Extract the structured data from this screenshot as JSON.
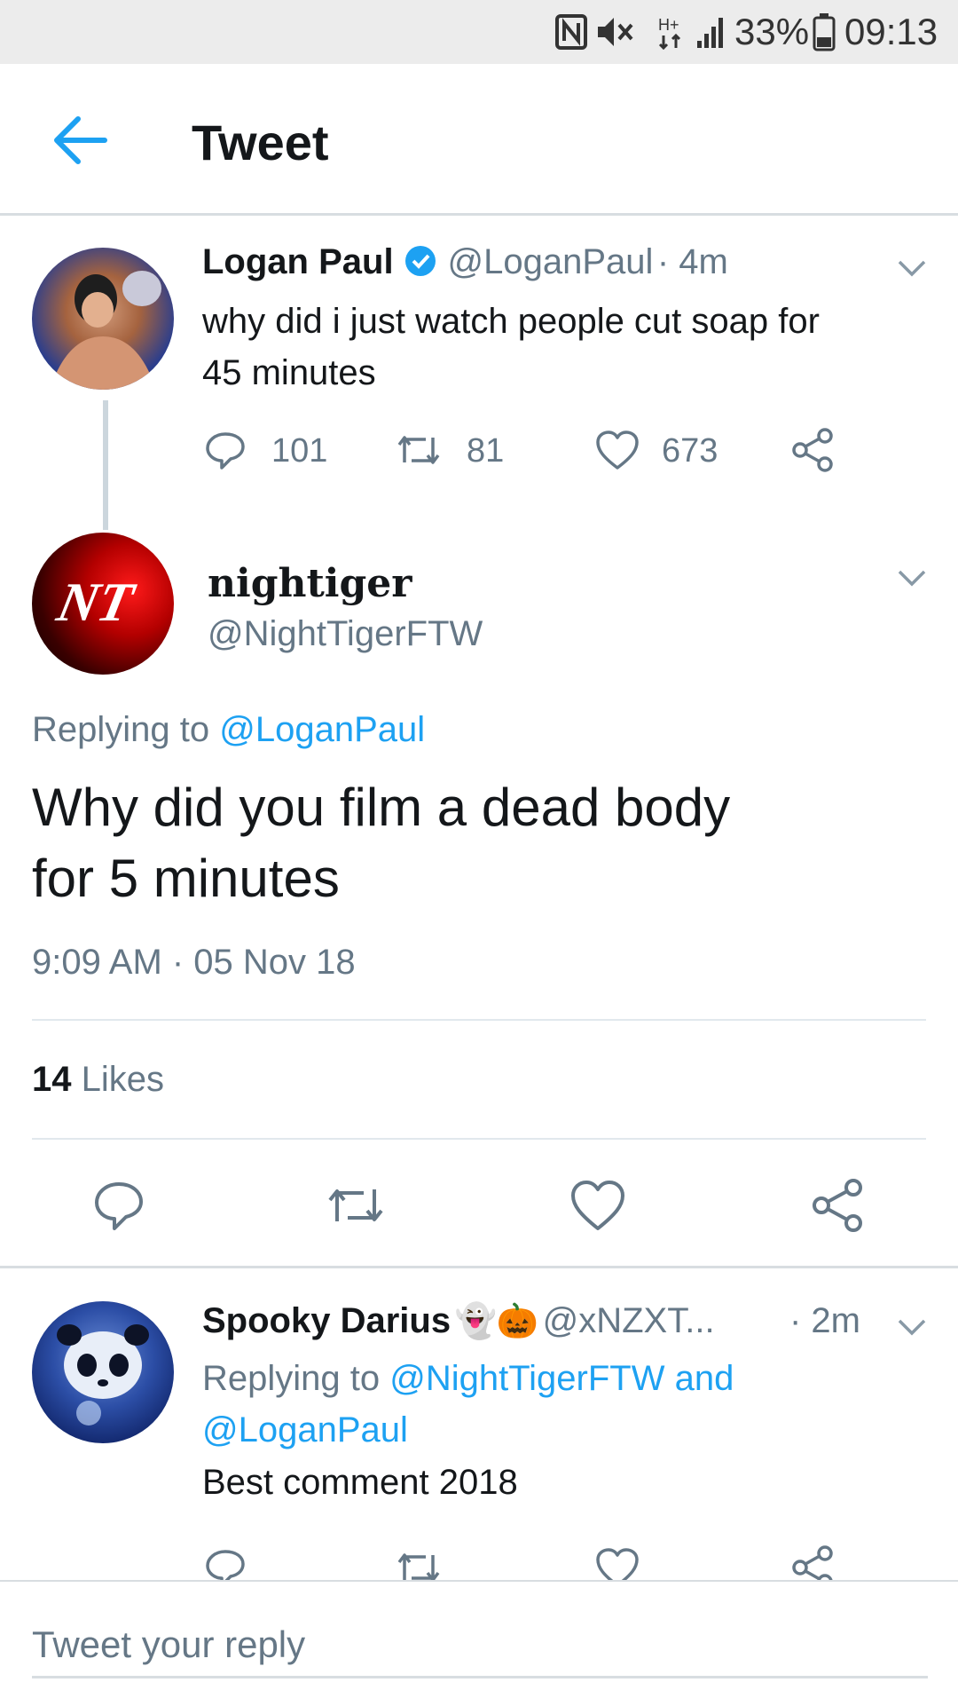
{
  "status_bar": {
    "battery": "33%",
    "time": "09:13"
  },
  "header": {
    "title": "Tweet"
  },
  "parent_tweet": {
    "name": "Logan Paul",
    "handle": "@LoganPaul",
    "time": "· 4m",
    "text_line1": "why did i just watch people cut soap for",
    "text_line2": "45 minutes",
    "replies": "101",
    "retweets": "81",
    "likes": "673"
  },
  "main_tweet": {
    "name": "nightiger",
    "handle": "@NightTigerFTW",
    "avatar_text": "NT",
    "replying_prefix": "Replying to ",
    "replying_to": "@LoganPaul",
    "text_line1": "Why did you film a dead body",
    "text_line2": "for 5 minutes",
    "timestamp": "9:09 AM · 05 Nov 18",
    "likes_count": "14",
    "likes_label": "Likes"
  },
  "reply_tweet": {
    "name": "Spooky Darius",
    "emoji": "👻🎃",
    "handle": "@xNZXT...",
    "time": "· 2m",
    "replying_prefix": "Replying to ",
    "replying_to_line1": "@NightTigerFTW and",
    "replying_to_line2": "@LoganPaul",
    "text": "Best comment 2018"
  },
  "reply_bar": {
    "placeholder": "Tweet your reply"
  },
  "colors": {
    "accent": "#1da1f2",
    "secondary_text": "#657786",
    "divider": "#e1e8ed"
  }
}
